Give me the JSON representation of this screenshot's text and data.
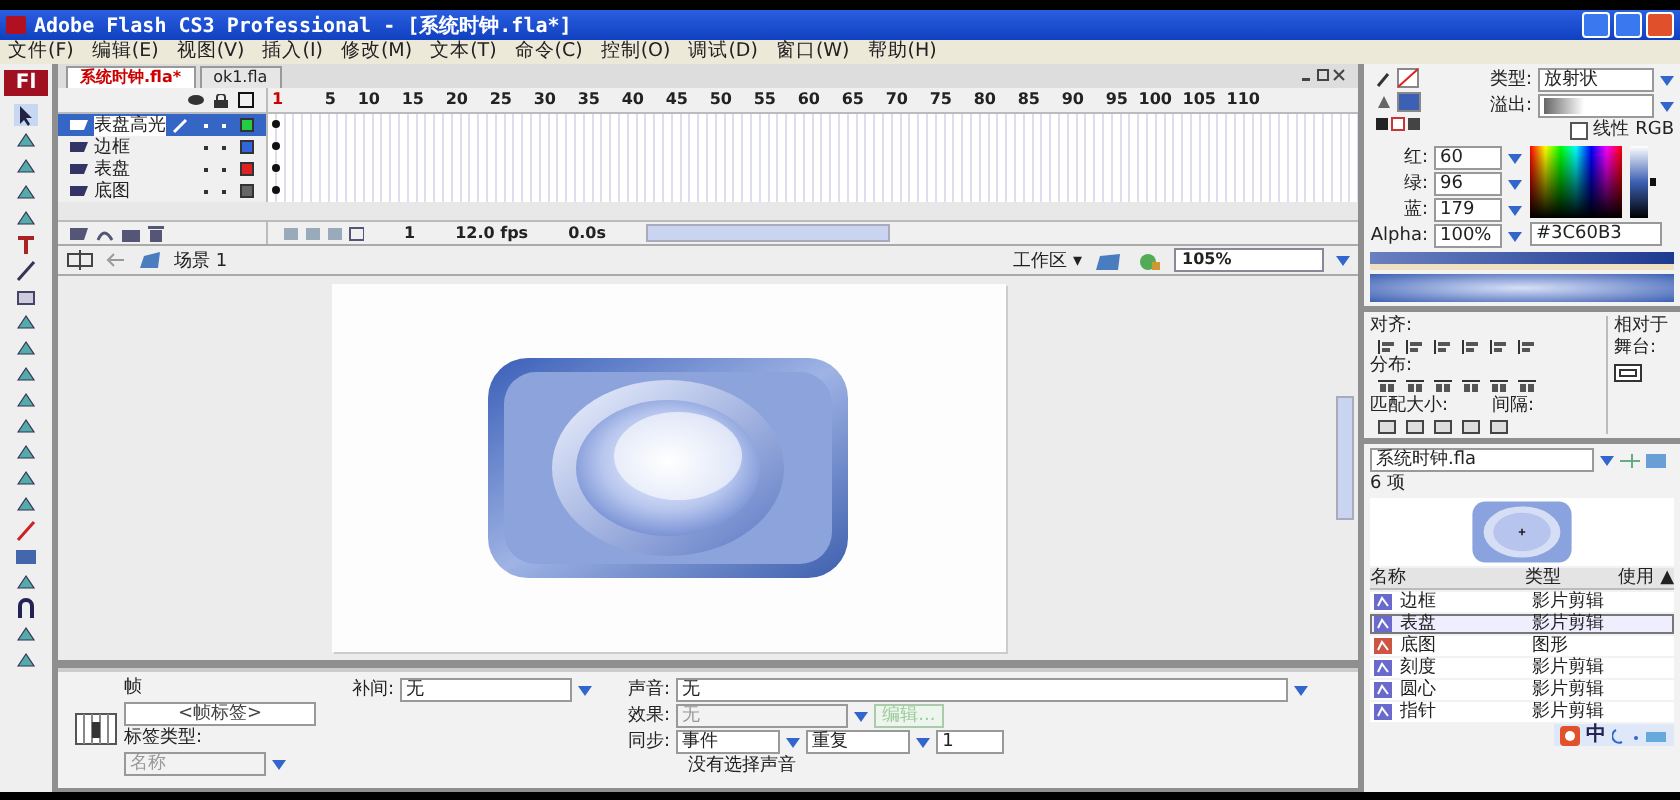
{
  "window": {
    "title": "Adobe Flash CS3 Professional - [系统时钟.fla*]"
  },
  "menu": [
    "文件(F)",
    "编辑(E)",
    "视图(V)",
    "插入(I)",
    "修改(M)",
    "文本(T)",
    "命令(C)",
    "控制(O)",
    "调试(D)",
    "窗口(W)",
    "帮助(H)"
  ],
  "toolbar": {
    "logo": "Fl"
  },
  "doc_tabs": [
    {
      "label": "系统时钟.fla*",
      "selected": true
    },
    {
      "label": "ok1.fla",
      "selected": false
    }
  ],
  "timeline": {
    "frame_numbers": [
      "1",
      "5",
      "10",
      "15",
      "20",
      "25",
      "30",
      "35",
      "40",
      "45",
      "50",
      "55",
      "60",
      "65",
      "70",
      "75",
      "80",
      "85",
      "90",
      "95",
      "100",
      "105",
      "110"
    ],
    "layers": [
      {
        "name": "表盘高光",
        "selected": true,
        "color": "#22cc44"
      },
      {
        "name": "边框",
        "selected": false,
        "color": "#3366dd"
      },
      {
        "name": "表盘",
        "selected": false,
        "color": "#dd2222"
      },
      {
        "name": "底图",
        "selected": false,
        "color": "#666666"
      }
    ],
    "current_frame": "1",
    "frame_rate": "12.0 fps",
    "elapsed": "0.0s"
  },
  "edit_bar": {
    "scene": "场景 1",
    "workspace": "工作区 ▾",
    "zoom": "105%"
  },
  "color_panel": {
    "type_label": "类型:",
    "type": "放射状",
    "overflow_label": "溢出:",
    "linear_rgb": {
      "label": "线性 RGB",
      "checked": false
    },
    "channels": [
      {
        "label": "红:",
        "value": "60"
      },
      {
        "label": "绿:",
        "value": "96"
      },
      {
        "label": "蓝:",
        "value": "179"
      },
      {
        "label": "Alpha:",
        "value": "100%"
      }
    ],
    "hex": "#3C60B3",
    "brightness": {
      "level": 0.5
    }
  },
  "align_panel": {
    "align": "对齐:",
    "distribute": "分布:",
    "match_size": "匹配大小:",
    "spacing": "间隔:",
    "to_stage": "相对于舞台:"
  },
  "library": {
    "file": "系统时钟.fla",
    "count": "6 项",
    "columns": [
      "名称",
      "类型",
      "使用 ▲"
    ],
    "items": [
      {
        "name": "边框",
        "type": "影片剪辑",
        "kind": "movieclip",
        "selected": false
      },
      {
        "name": "表盘",
        "type": "影片剪辑",
        "kind": "movieclip",
        "selected": true
      },
      {
        "name": "底图",
        "type": "图形",
        "kind": "graphic",
        "selected": false
      },
      {
        "name": "刻度",
        "type": "影片剪辑",
        "kind": "movieclip",
        "selected": false
      },
      {
        "name": "圆心",
        "type": "影片剪辑",
        "kind": "movieclip",
        "selected": false
      },
      {
        "name": "指针",
        "type": "影片剪辑",
        "kind": "movieclip",
        "selected": false
      }
    ]
  },
  "properties": {
    "title": "帧",
    "frame_label": {
      "placeholder": "<帧标签>"
    },
    "label_type": "标签类型:",
    "label_type_value": "名称",
    "tween_label": "补间:",
    "tween": "无",
    "sound_label": "声音:",
    "sound": "无",
    "effect_label": "效果:",
    "effect": "无",
    "edit_button": "编辑...",
    "sync_label": "同步:",
    "sync": "事件",
    "repeat": "重复",
    "repeat_count": "1",
    "status": "没有选择声音"
  },
  "ime_bar": {
    "mode": "中"
  }
}
